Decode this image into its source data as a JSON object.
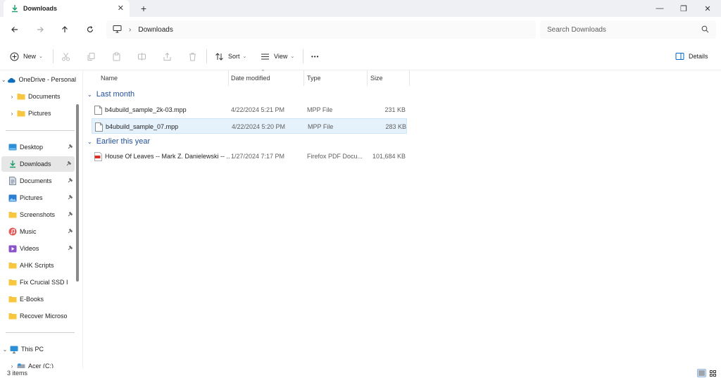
{
  "tab": {
    "title": "Downloads",
    "close": "✕",
    "new_tab": "+"
  },
  "window": {
    "minimize": "—",
    "maximize": "❐",
    "close": "✕"
  },
  "address": {
    "separator": "›",
    "location": "Downloads"
  },
  "search": {
    "placeholder": "Search Downloads"
  },
  "commands": {
    "new_label": "New",
    "sort_label": "Sort",
    "view_label": "View",
    "more_label": "•••",
    "details_label": "Details",
    "caret": "⌄"
  },
  "sidebar": {
    "chevron_down": "⌄",
    "chevron_right": "›",
    "items": [
      {
        "label": "OneDrive - Personal"
      },
      {
        "label": "Documents"
      },
      {
        "label": "Pictures"
      },
      {
        "label": "Desktop"
      },
      {
        "label": "Downloads"
      },
      {
        "label": "Documents"
      },
      {
        "label": "Pictures"
      },
      {
        "label": "Screenshots"
      },
      {
        "label": "Music"
      },
      {
        "label": "Videos"
      },
      {
        "label": "AHK Scripts"
      },
      {
        "label": "Fix Crucial SSD I"
      },
      {
        "label": "E-Books"
      },
      {
        "label": "Recover Microso"
      },
      {
        "label": "This PC"
      },
      {
        "label": "Acer (C:)"
      }
    ]
  },
  "columns": {
    "name": "Name",
    "date": "Date modified",
    "type": "Type",
    "size": "Size",
    "sort_caret": "^"
  },
  "groups": [
    {
      "label": "Last month",
      "chevron": "⌄"
    },
    {
      "label": "Earlier this year",
      "chevron": "⌄"
    }
  ],
  "files": [
    {
      "name": "b4ubuild_sample_2k-03.mpp",
      "date": "4/22/2024 5:21 PM",
      "type": "MPP File",
      "size": "231 KB"
    },
    {
      "name": "b4ubuild_sample_07.mpp",
      "date": "4/22/2024 5:20 PM",
      "type": "MPP File",
      "size": "283 KB"
    },
    {
      "name": "House Of Leaves -- Mark Z. Danielewski -- ...",
      "date": "1/27/2024 7:17 PM",
      "type": "Firefox PDF Docu...",
      "size": "101,684 KB"
    }
  ],
  "status": {
    "item_count": "3 items"
  },
  "colors": {
    "accent": "#0067c0",
    "selected_row": "#e5f1fb",
    "group_header": "#1f4f99",
    "folder": "#f8c640"
  }
}
